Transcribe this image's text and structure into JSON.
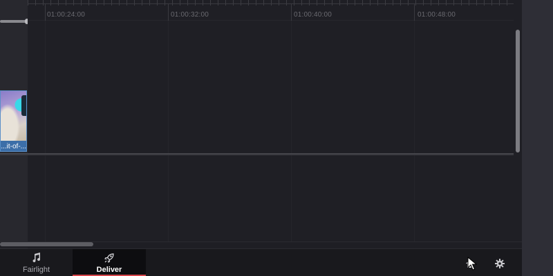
{
  "timeline": {
    "ruler": {
      "timecodes": [
        "01:00:24:00",
        "01:00:32:00",
        "01:00:40:00",
        "01:00:48:00"
      ]
    },
    "clip": {
      "name": "...it-of-..."
    }
  },
  "page_nav": {
    "tabs": [
      {
        "label": "Fairlight",
        "icon": "music-note-icon",
        "active": false
      },
      {
        "label": "Deliver",
        "icon": "rocket-icon",
        "active": true
      }
    ],
    "right_icons": [
      "home-icon",
      "gear-icon"
    ]
  },
  "colors": {
    "active_tab_underline": "#d8454a",
    "clip_border": "#5a8fc8",
    "panel_background": "#1f1f25"
  }
}
